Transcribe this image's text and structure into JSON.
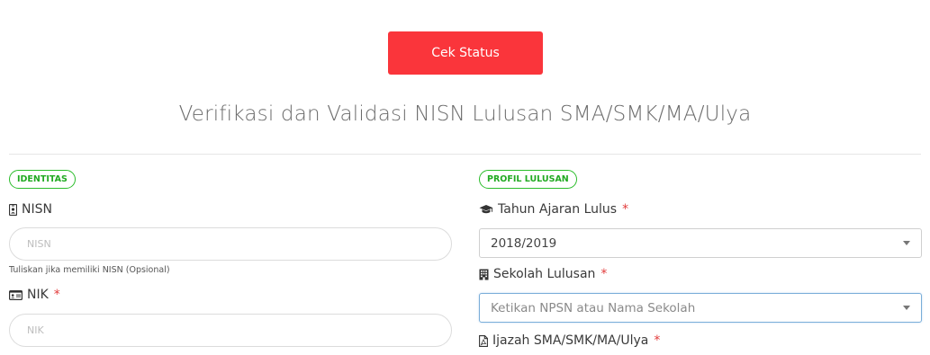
{
  "header": {
    "cek_status_label": "Cek Status",
    "title": "Verifikasi dan Validasi NISN Lulusan SMA/SMK/MA/Ulya"
  },
  "identitas": {
    "badge": "IDENTITAS",
    "nisn": {
      "label": "NISN",
      "icon": "id-badge-icon",
      "placeholder": "NISN",
      "helper": "Tuliskan jika memiliki NISN (Opsional)"
    },
    "nik": {
      "label": "NIK",
      "icon": "id-card-icon",
      "required": "*",
      "placeholder": "NIK"
    }
  },
  "profil": {
    "badge": "PROFIL LULUSAN",
    "tahun": {
      "label": "Tahun Ajaran Lulus",
      "icon": "graduation-cap-icon",
      "required": "*",
      "value": "2018/2019"
    },
    "sekolah": {
      "label": "Sekolah Lulusan",
      "icon": "building-icon",
      "required": "*",
      "placeholder": "Ketikan NPSN atau Nama Sekolah"
    },
    "ijazah": {
      "label": "Ijazah SMA/SMK/MA/Ulya",
      "icon": "file-pdf-icon",
      "required": "*"
    }
  },
  "colors": {
    "primary_button": "#fa353b",
    "badge_green": "#2bbd2b",
    "required_red": "#e23b3b"
  }
}
